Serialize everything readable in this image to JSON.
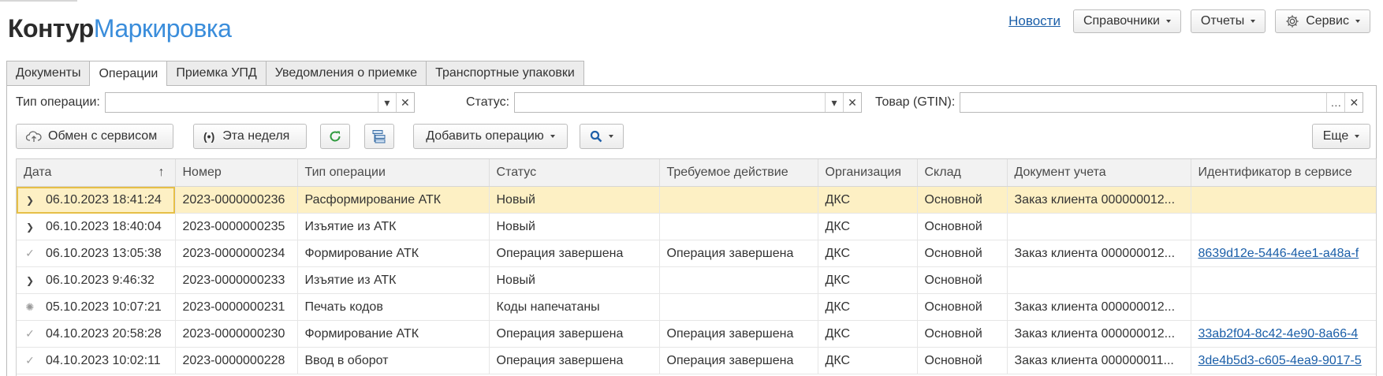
{
  "logo": {
    "part1": "Контур",
    "part2": "Маркировка"
  },
  "header": {
    "news": "Новости",
    "references": "Справочники",
    "reports": "Отчеты",
    "service": "Сервис"
  },
  "tabs": [
    "Документы",
    "Операции",
    "Приемка УПД",
    "Уведомления о приемке",
    "Транспортные упаковки"
  ],
  "filters": {
    "op_type_label": "Тип операции:",
    "status_label": "Статус:",
    "goods_label": "Товар (GTIN):",
    "op_type_value": "",
    "status_value": "",
    "goods_value": ""
  },
  "toolbar": {
    "exchange": "Обмен с сервисом",
    "this_week": "Эта неделя",
    "add_operation": "Добавить операцию",
    "more": "Еще"
  },
  "table": {
    "headers": [
      "Дата",
      "Номер",
      "Тип операции",
      "Статус",
      "Требуемое действие",
      "Организация",
      "Склад",
      "Документ учета",
      "Идентификатор в сервисе"
    ],
    "rows": [
      {
        "icon": "chevron-right-icon",
        "date": "06.10.2023 18:41:24",
        "number": "2023-0000000236",
        "type": "Расформирование АТК",
        "status": "Новый",
        "action": "",
        "org": "ДКС",
        "warehouse": "Основной",
        "doc": "Заказ клиента 000000012...",
        "id": ""
      },
      {
        "icon": "chevron-right-icon",
        "date": "06.10.2023 18:40:04",
        "number": "2023-0000000235",
        "type": "Изъятие из АТК",
        "status": "Новый",
        "action": "",
        "org": "ДКС",
        "warehouse": "Основной",
        "doc": "",
        "id": ""
      },
      {
        "icon": "check-icon",
        "date": "06.10.2023 13:05:38",
        "number": "2023-0000000234",
        "type": "Формирование АТК",
        "status": "Операция завершена",
        "action": "Операция завершена",
        "org": "ДКС",
        "warehouse": "Основной",
        "doc": "Заказ клиента 000000012...",
        "id": "8639d12e-5446-4ee1-a48a-f"
      },
      {
        "icon": "chevron-right-icon",
        "date": "06.10.2023 9:46:32",
        "number": "2023-0000000233",
        "type": "Изъятие из АТК",
        "status": "Новый",
        "action": "",
        "org": "ДКС",
        "warehouse": "Основной",
        "doc": "",
        "id": ""
      },
      {
        "icon": "spinner-icon",
        "date": "05.10.2023 10:07:21",
        "number": "2023-0000000231",
        "type": "Печать кодов",
        "status": "Коды напечатаны",
        "action": "",
        "org": "ДКС",
        "warehouse": "Основной",
        "doc": "Заказ клиента 000000012...",
        "id": ""
      },
      {
        "icon": "check-icon",
        "date": "04.10.2023 20:58:28",
        "number": "2023-0000000230",
        "type": "Формирование АТК",
        "status": "Операция завершена",
        "action": "Операция завершена",
        "org": "ДКС",
        "warehouse": "Основной",
        "doc": "Заказ клиента 000000012...",
        "id": "33ab2f04-8c42-4e90-8a66-4"
      },
      {
        "icon": "check-icon",
        "date": "04.10.2023 10:02:11",
        "number": "2023-0000000228",
        "type": "Ввод в оборот",
        "status": "Операция завершена",
        "action": "Операция завершена",
        "org": "ДКС",
        "warehouse": "Основной",
        "doc": "Заказ клиента 000000011...",
        "id": "3de4b5d3-c605-4ea9-9017-5"
      }
    ]
  }
}
